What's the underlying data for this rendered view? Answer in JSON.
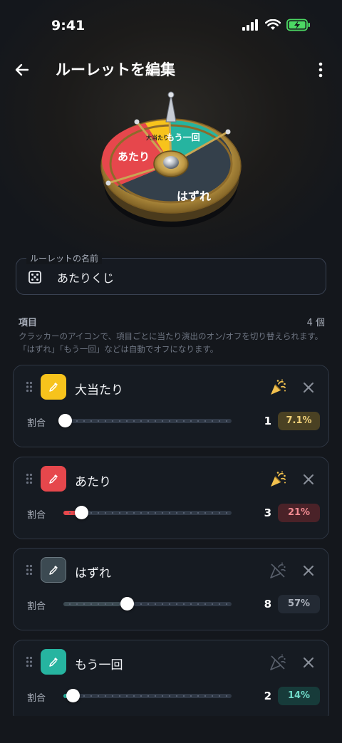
{
  "status_bar": {
    "time": "9:41"
  },
  "header": {
    "title": "ルーレットを編集"
  },
  "wheel": {
    "segments": [
      {
        "label": "大当たり",
        "color": "#f7c31c"
      },
      {
        "label": "もう一回",
        "color": "#26b4a0"
      },
      {
        "label": "はずれ",
        "color": "#34404b"
      },
      {
        "label": "あたり",
        "color": "#e6474c"
      }
    ]
  },
  "name_field": {
    "legend": "ルーレットの名前",
    "value": "あたりくじ"
  },
  "items_section": {
    "title": "項目",
    "count": "4 個",
    "description": "クラッカーのアイコンで、項目ごとに当たり演出のオン/オフを切り替えられます。「はずれ」「もう一回」などは自動でオフになります。"
  },
  "items": [
    {
      "name": "大当たり",
      "color": "#f7c31c",
      "celebration": true,
      "ratio_label": "割合",
      "value": "1",
      "percent": "7.1%",
      "fraction": 0.0,
      "pct_bg": "#4a4123",
      "pct_fg": "#f2d27a"
    },
    {
      "name": "あたり",
      "color": "#e6474c",
      "celebration": true,
      "ratio_label": "割合",
      "value": "3",
      "percent": "21%",
      "fraction": 0.1,
      "pct_bg": "#4a2228",
      "pct_fg": "#f28b92"
    },
    {
      "name": "はずれ",
      "color": "#3c4a52",
      "celebration": false,
      "ratio_label": "割合",
      "value": "8",
      "percent": "57%",
      "fraction": 0.37,
      "pct_bg": "#232a34",
      "pct_fg": "#aeb4be"
    },
    {
      "name": "もう一回",
      "color": "#26b4a0",
      "celebration": false,
      "ratio_label": "割合",
      "value": "2",
      "percent": "14%",
      "fraction": 0.05,
      "pct_bg": "#173b3a",
      "pct_fg": "#6fd9c8"
    }
  ]
}
